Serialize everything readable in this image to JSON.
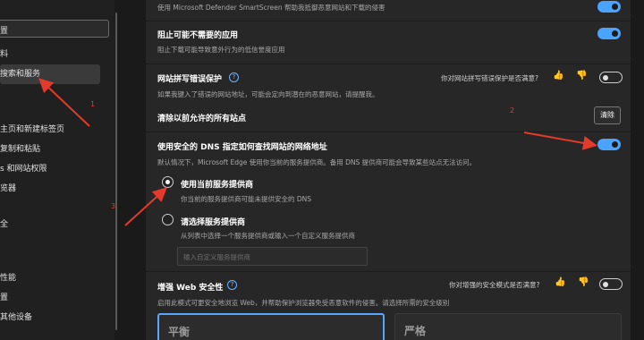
{
  "sidebar": {
    "search_value": "置",
    "items": [
      {
        "label": "料"
      },
      {
        "label": "搜索和服务"
      },
      {
        "label": "主页和新建标签页"
      },
      {
        "label": "复制和粘贴"
      },
      {
        "label": "s 和网站权限"
      },
      {
        "label": "览器"
      },
      {
        "label": "全"
      },
      {
        "label": "性能"
      },
      {
        "label": "置"
      },
      {
        "label": "其他设备"
      }
    ]
  },
  "settings": {
    "top_desc": "使用 Microsoft Defender SmartScreen 帮助我抵御恶意网站和下载的侵害",
    "block_apps": {
      "title": "阻止可能不需要的应用",
      "desc": "阻止下载可能导致意外行为的低信誉度应用",
      "enabled": true
    },
    "typo_protection": {
      "title": "网站拼写错误保护",
      "desc": "如果我键入了错误的网站地址，可能会定向到潜在的恶意网站，请提醒我。",
      "feedback": "你对网站拼写错误保护是否满意?",
      "enabled": false
    },
    "clear_allowed": {
      "title": "清除以前允许的所有站点",
      "button_label": "清除"
    },
    "secure_dns": {
      "title": "使用安全的 DNS 指定如何查找网站的网络地址",
      "desc": "默认情况下，Microsoft Edge 使用你当前的服务提供商。备用 DNS 提供商可能会导致某些站点无法访问。",
      "enabled": true,
      "option_current": {
        "label": "使用当前服务提供商",
        "desc": "你当前的服务提供商可能未提供安全的 DNS",
        "checked": true
      },
      "option_choose": {
        "label": "请选择服务提供商",
        "desc": "从列表中选择一个服务提供商或输入一个自定义服务提供商",
        "checked": false
      },
      "custom_placeholder": "输入自定义服务提供商"
    },
    "enhanced_security": {
      "title": "增强 Web 安全性",
      "desc": "启用此模式可更安全地浏览 Web，并帮助保护浏览器免受恶意软件的侵害。请选择所需的安全级别",
      "feedback": "你对增强的安全模式是否满意?",
      "enabled": false,
      "levels": [
        {
          "label": "平衡",
          "selected": true
        },
        {
          "label": "严格",
          "selected": false
        }
      ]
    }
  },
  "annotations": [
    {
      "label": "1"
    },
    {
      "label": "2"
    },
    {
      "label": "3"
    }
  ],
  "colors": {
    "accent": "#4aa3ff",
    "annotation_red": "#e33b2b"
  }
}
